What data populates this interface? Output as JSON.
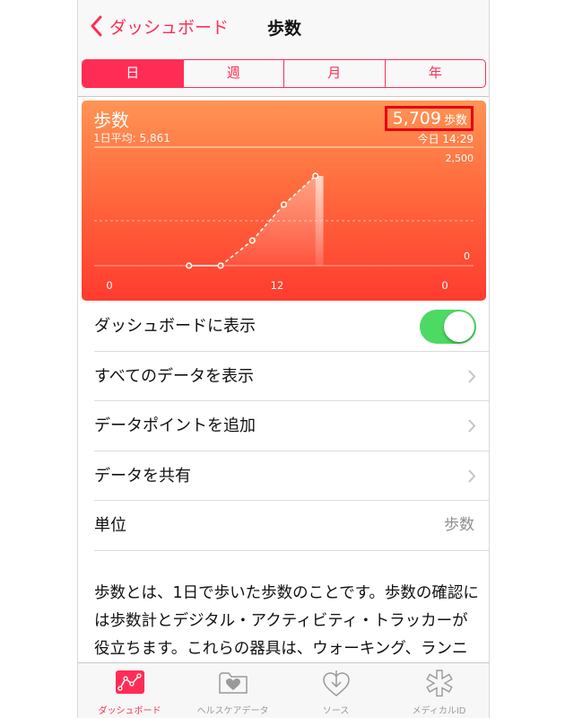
{
  "nav": {
    "back_label": "ダッシュボード",
    "title": "歩数"
  },
  "segments": [
    {
      "label": "日",
      "active": true
    },
    {
      "label": "週",
      "active": false
    },
    {
      "label": "月",
      "active": false
    },
    {
      "label": "年",
      "active": false
    }
  ],
  "card": {
    "title": "歩数",
    "average": "1日平均: 5,861",
    "value": "5,709",
    "unit": "歩数",
    "time": "今日 14:29",
    "ymax_label": "2,500",
    "ymin_label": "0",
    "x_labels": [
      "0",
      "12",
      "0"
    ]
  },
  "chart_data": {
    "type": "line",
    "x_ticks": [
      "0",
      "12",
      "0"
    ],
    "x": [
      6,
      8,
      10,
      12,
      14,
      14.5
    ],
    "y": [
      0,
      0,
      700,
      1700,
      2500,
      2500
    ],
    "ylim": [
      0,
      2500
    ],
    "xlim": [
      0,
      24
    ],
    "y_tick_labels": [
      "2,500",
      "0"
    ]
  },
  "list": {
    "show_on_dashboard": "ダッシュボードに表示",
    "show_all_data": "すべてのデータを表示",
    "add_data_point": "データポイントを追加",
    "share_data": "データを共有",
    "unit_label": "単位",
    "unit_value": "歩数"
  },
  "description": "歩数とは、1日で歩いた歩数のことです。歩数の確認には歩数計とデジタル・アクティビティ・トラッカーが役立ちます。これらの器具は、ウォーキング、ランニング、階段上り、クロスカ",
  "tabs": [
    {
      "label": "ダッシュボード",
      "icon": "dashboard-icon",
      "active": true
    },
    {
      "label": "ヘルスケアデータ",
      "icon": "health-data-icon",
      "active": false
    },
    {
      "label": "ソース",
      "icon": "sources-icon",
      "active": false
    },
    {
      "label": "メディカルID",
      "icon": "medical-id-icon",
      "active": false
    }
  ],
  "colors": {
    "accent": "#ff2d55",
    "toggle_on": "#4cd964",
    "highlight_box": "#e60012"
  }
}
